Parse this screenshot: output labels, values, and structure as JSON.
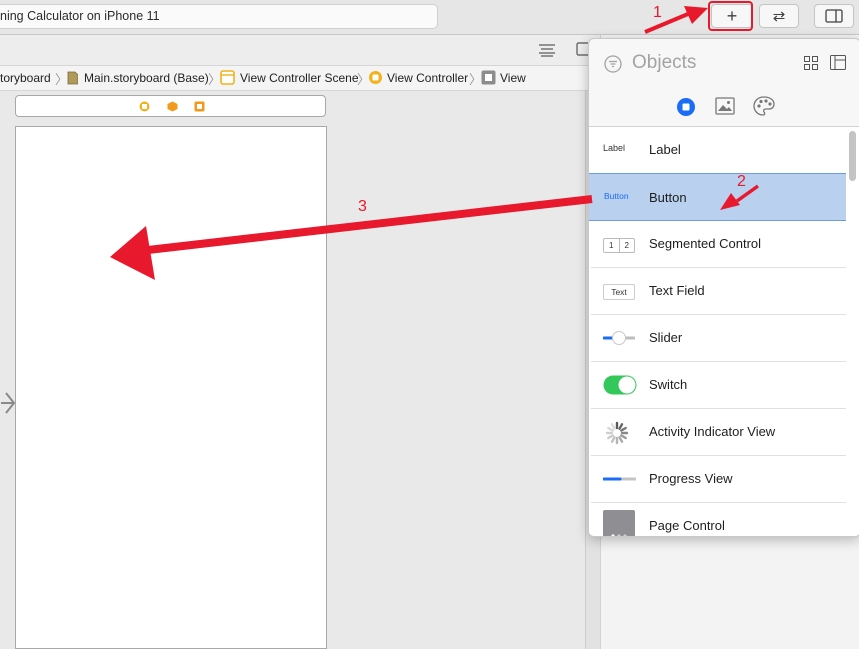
{
  "toolbar": {
    "status_text": "ning Calculator on iPhone 11",
    "add_label": "+",
    "swap_label": "⇄"
  },
  "jumpbar": {
    "crumbs": [
      "toryboard",
      "Main.storyboard (Base)",
      "View Controller Scene",
      "View Controller",
      "View"
    ]
  },
  "library": {
    "title": "Objects",
    "items": [
      {
        "label": "Label",
        "thumb_text": "Label"
      },
      {
        "label": "Button",
        "thumb_text": "Button"
      },
      {
        "label": "Segmented Control",
        "thumb_text_1": "1",
        "thumb_text_2": "2"
      },
      {
        "label": "Text Field",
        "thumb_text": "Text"
      },
      {
        "label": "Slider"
      },
      {
        "label": "Switch"
      },
      {
        "label": "Activity Indicator View"
      },
      {
        "label": "Progress View"
      },
      {
        "label": "Page Control"
      }
    ],
    "selected_index": 1
  },
  "annotations": {
    "step1": "1",
    "step2": "2",
    "step3": "3"
  },
  "colors": {
    "accent": "#1a6ef5",
    "annotation": "#e8192c",
    "switch_on": "#34c759",
    "selection": "#b9d0ef"
  }
}
